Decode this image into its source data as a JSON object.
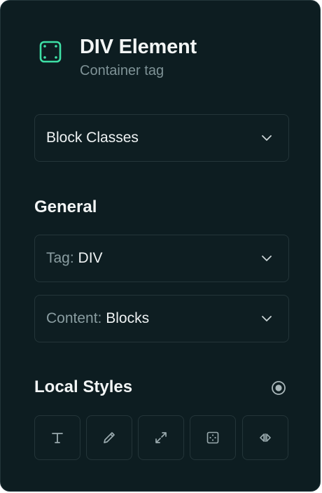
{
  "header": {
    "title": "DIV Element",
    "subtitle": "Container tag",
    "icon": "div-element-icon",
    "accent_color": "#3ee0a6"
  },
  "block_classes": {
    "label": "Block Classes",
    "icon": "chevron-down-icon"
  },
  "general": {
    "title": "General",
    "tag": {
      "prefix": "Tag:",
      "value": "DIV"
    },
    "content": {
      "prefix": "Content:",
      "value": "Blocks"
    }
  },
  "local_styles": {
    "title": "Local Styles",
    "toggle_icon": "radio-dot-icon",
    "tools": [
      {
        "name": "typography",
        "icon": "text-icon"
      },
      {
        "name": "color",
        "icon": "pencil-icon"
      },
      {
        "name": "size",
        "icon": "expand-icon"
      },
      {
        "name": "spacing",
        "icon": "grid-dots-icon"
      },
      {
        "name": "layout",
        "icon": "arrows-horizontal-icon"
      }
    ]
  }
}
